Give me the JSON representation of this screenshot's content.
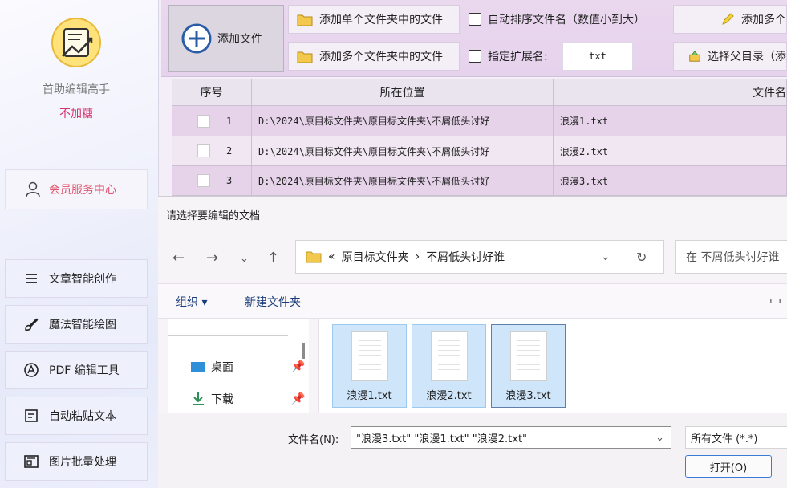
{
  "sidebar": {
    "app_name": "首助编辑高手",
    "app_sub": "不加糖",
    "member_label": "会员服务中心",
    "menu": [
      {
        "label": "文章智能创作",
        "icon": "menu-lines-icon"
      },
      {
        "label": "魔法智能绘图",
        "icon": "brush-icon"
      },
      {
        "label": "PDF 编辑工具",
        "icon": "pdf-icon"
      },
      {
        "label": "自动粘贴文本",
        "icon": "paste-icon"
      },
      {
        "label": "图片批量处理",
        "icon": "image-icon"
      }
    ]
  },
  "toolbar": {
    "add_file": "添加文件",
    "add_single_folder": "添加单个文件夹中的文件",
    "add_multi_folder": "添加多个文件夹中的文件",
    "auto_sort": "自动排序文件名（数值小到大）",
    "ext_label": "指定扩展名:",
    "ext_value": "txt",
    "add_multi_right": "添加多个",
    "select_parent": "选择父目录（添"
  },
  "table": {
    "headers": [
      "序号",
      "所在位置",
      "文件名"
    ],
    "rows": [
      {
        "no": "1",
        "location": "D:\\2024\\原目标文件夹\\原目标文件夹\\不屑低头讨好",
        "file": "浪漫1.txt"
      },
      {
        "no": "2",
        "location": "D:\\2024\\原目标文件夹\\原目标文件夹\\不屑低头讨好",
        "file": "浪漫2.txt"
      },
      {
        "no": "3",
        "location": "D:\\2024\\原目标文件夹\\原目标文件夹\\不屑低头讨好",
        "file": "浪漫3.txt"
      }
    ]
  },
  "dialog": {
    "title": "请选择要编辑的文档",
    "path_prefix": "«",
    "path_parent": "原目标文件夹",
    "path_current": "不屑低头讨好谁",
    "search_placeholder": "在 不屑低头讨好谁",
    "organize": "组织 ▾",
    "new_folder": "新建文件夹",
    "nav": [
      {
        "label": "桌面",
        "icon": "desktop-icon"
      },
      {
        "label": "下载",
        "icon": "download-icon"
      }
    ],
    "files": [
      "浪漫1.txt",
      "浪漫2.txt",
      "浪漫3.txt"
    ],
    "filename_label": "文件名(N):",
    "filename_value": "\"浪漫3.txt\" \"浪漫1.txt\" \"浪漫2.txt\"",
    "filetype": "所有文件 (*.*)",
    "open_label": "打开(O)"
  }
}
